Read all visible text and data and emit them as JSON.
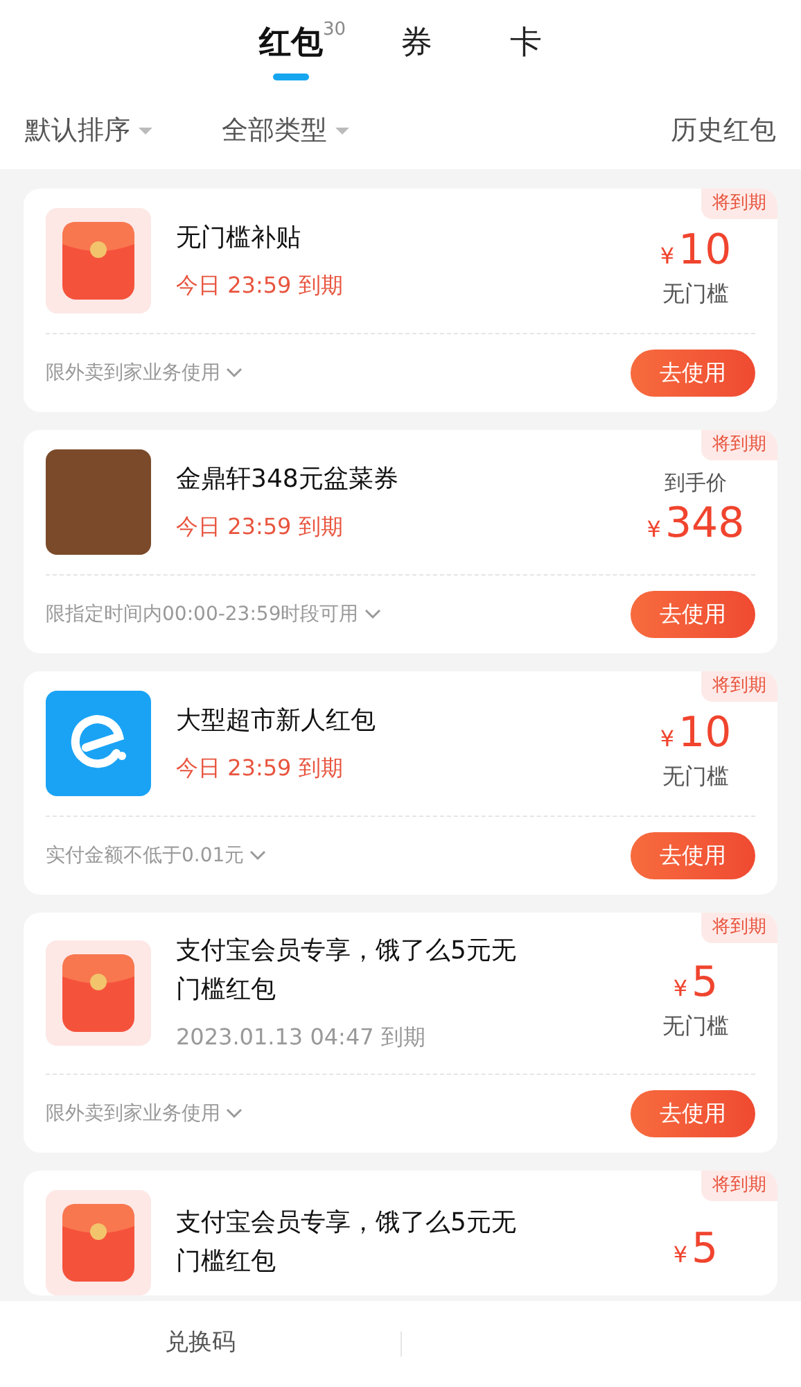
{
  "tabs": [
    {
      "label": "红包",
      "count": "30",
      "selected": true
    },
    {
      "label": "券",
      "selected": false
    },
    {
      "label": "卡",
      "selected": false
    }
  ],
  "filters": [
    {
      "label": "默认排序"
    },
    {
      "label": "全部类型"
    }
  ],
  "history_link": "历史红包",
  "coupons": [
    {
      "kind": "redpacket",
      "tag": "将到期",
      "title": "无门槛补贴",
      "expiry": "今日 23:59 到期",
      "urgent": true,
      "currency": "¥",
      "amount": "10",
      "threshold": "无门槛",
      "restriction": "限外卖到家业务使用",
      "action": "去使用"
    },
    {
      "kind": "photo",
      "tag": "将到期",
      "title": "金鼎轩348元盆菜券",
      "expiry": "今日 23:59 到期",
      "urgent": true,
      "price_label": "到手价",
      "currency": "¥",
      "amount": "348",
      "restriction": "限指定时间内00:00-23:59时段可用",
      "action": "去使用"
    },
    {
      "kind": "app",
      "tag": "将到期",
      "title": "大型超市新人红包",
      "expiry": "今日 23:59 到期",
      "urgent": true,
      "currency": "¥",
      "amount": "10",
      "threshold": "无门槛",
      "restriction": "实付金额不低于0.01元",
      "action": "去使用"
    },
    {
      "kind": "redpacket",
      "tag": "将到期",
      "title": "支付宝会员专享，饿了么5元无门槛红包",
      "expiry": "2023.01.13 04:47 到期",
      "urgent": false,
      "currency": "¥",
      "amount": "5",
      "threshold": "无门槛",
      "restriction": "限外卖到家业务使用",
      "action": "去使用"
    },
    {
      "kind": "redpacket",
      "tag": "将到期",
      "title": "支付宝会员专享，饿了么5元无门槛红包",
      "currency": "¥",
      "amount": "5"
    }
  ],
  "bottom_bar": [
    {
      "label": "兑换码"
    }
  ]
}
